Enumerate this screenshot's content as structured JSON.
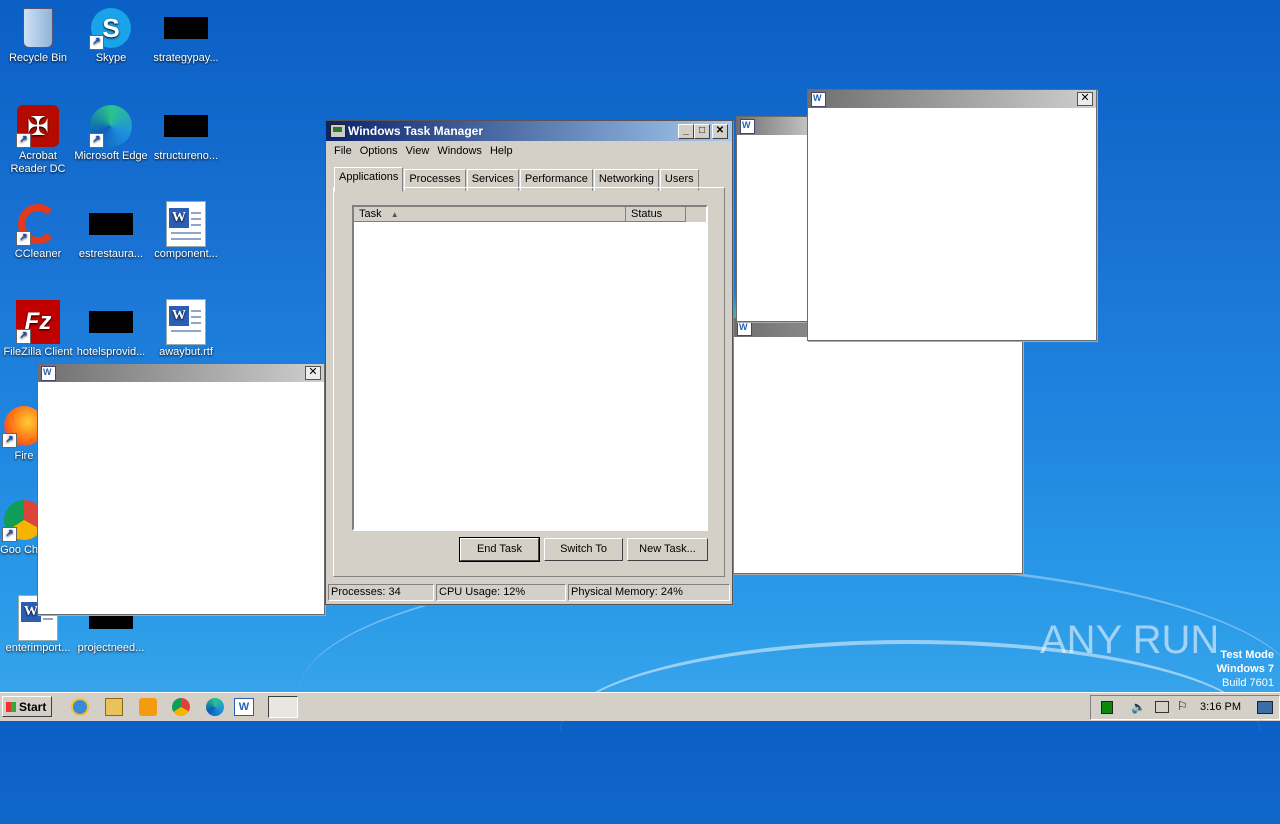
{
  "desktop": {
    "icons": [
      {
        "label": "Recycle Bin"
      },
      {
        "label": "Skype"
      },
      {
        "label": "strategypay..."
      },
      {
        "label": "Acrobat Reader DC"
      },
      {
        "label": "Microsoft Edge"
      },
      {
        "label": "structureno..."
      },
      {
        "label": "CCleaner"
      },
      {
        "label": "estrestaura..."
      },
      {
        "label": "component..."
      },
      {
        "label": "FileZilla Client"
      },
      {
        "label": "hotelsprovid..."
      },
      {
        "label": "awaybut.rtf"
      },
      {
        "label": "Fire"
      },
      {
        "label": "Goo Chro"
      },
      {
        "label": "enterimport..."
      },
      {
        "label": "projectneed..."
      }
    ]
  },
  "taskmgr": {
    "title": "Windows Task Manager",
    "menu": [
      "File",
      "Options",
      "View",
      "Windows",
      "Help"
    ],
    "tabs": [
      "Applications",
      "Processes",
      "Services",
      "Performance",
      "Networking",
      "Users"
    ],
    "columns": [
      "Task",
      "Status"
    ],
    "buttons": {
      "end": "End Task",
      "switch": "Switch To",
      "new": "New Task..."
    },
    "status": {
      "processes": "Processes: 34",
      "cpu": "CPU Usage: 12%",
      "memory": "Physical Memory: 24%"
    }
  },
  "taskbar": {
    "start": "Start",
    "clock": "3:16 PM"
  },
  "watermark": {
    "brand": "ANY RUN",
    "line1": "Test Mode",
    "line2": "Windows 7",
    "line3": "Build 7601"
  }
}
